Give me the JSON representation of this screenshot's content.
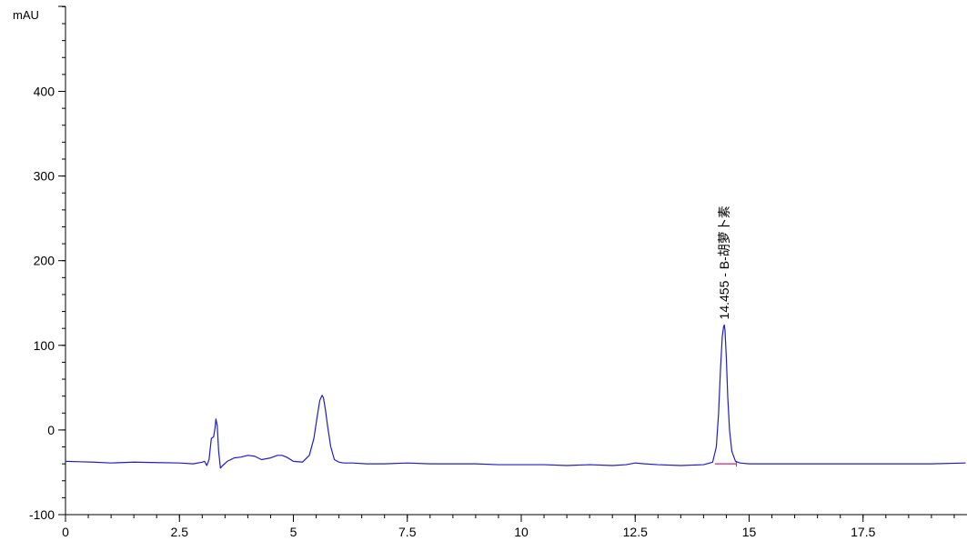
{
  "chart_data": {
    "type": "line",
    "title": "",
    "xlabel": "",
    "ylabel": "mAU",
    "xlim": [
      0,
      19.75
    ],
    "ylim": [
      -100,
      500
    ],
    "x_ticks": [
      0,
      2.5,
      5,
      7.5,
      10,
      12.5,
      15,
      17.5
    ],
    "x_tick_labels": [
      "0",
      "2.5",
      "5",
      "7.5",
      "10",
      "12.5",
      "15",
      "17.5"
    ],
    "x_minor_step": 0.5,
    "y_ticks": [
      -100,
      0,
      100,
      200,
      300,
      400
    ],
    "y_tick_labels": [
      "-100",
      "0",
      "100",
      "200",
      "300",
      "400"
    ],
    "y_minor_step": 20,
    "grid": false,
    "series": [
      {
        "color": "#1f1fbf",
        "x": [
          0,
          0.3,
          0.6,
          1.0,
          1.5,
          2.0,
          2.5,
          2.8,
          3.0,
          3.05,
          3.1,
          3.15,
          3.2,
          3.25,
          3.28,
          3.3,
          3.33,
          3.36,
          3.4,
          3.45,
          3.55,
          3.7,
          3.85,
          4.0,
          4.15,
          4.3,
          4.5,
          4.65,
          4.75,
          4.85,
          5.0,
          5.2,
          5.35,
          5.45,
          5.52,
          5.58,
          5.63,
          5.66,
          5.7,
          5.75,
          5.82,
          5.9,
          6.0,
          6.1,
          6.3,
          6.6,
          7.0,
          7.5,
          8.0,
          8.5,
          9.0,
          9.5,
          10.0,
          10.5,
          11.0,
          11.5,
          12.0,
          12.3,
          12.5,
          12.7,
          13.0,
          13.5,
          14.0,
          14.2,
          14.28,
          14.33,
          14.37,
          14.41,
          14.44,
          14.455,
          14.47,
          14.5,
          14.53,
          14.57,
          14.62,
          14.7,
          14.8,
          15.0,
          15.5,
          16.0,
          16.5,
          17.0,
          17.5,
          18.0,
          18.5,
          19.0,
          19.75
        ],
        "y": [
          -37,
          -37.5,
          -38,
          -39,
          -38,
          -38.5,
          -39,
          -40,
          -38,
          -37,
          -42,
          -35,
          -10,
          -8,
          2,
          13,
          5,
          -25,
          -45,
          -42,
          -37,
          -33,
          -32,
          -30,
          -31,
          -35,
          -33,
          -30,
          -30,
          -32,
          -37,
          -38,
          -30,
          -10,
          15,
          35,
          41,
          38,
          25,
          5,
          -20,
          -35,
          -38,
          -39,
          -39,
          -40,
          -40,
          -39,
          -40,
          -40,
          -40,
          -41,
          -41,
          -41,
          -42,
          -41,
          -42,
          -41,
          -39,
          -40,
          -41,
          -42,
          -41,
          -38,
          -20,
          20,
          70,
          110,
          122,
          124,
          118,
          85,
          40,
          0,
          -25,
          -37,
          -39,
          -40,
          -40,
          -40,
          -40,
          -40,
          -40,
          -40,
          -40,
          -40,
          -39
        ]
      }
    ],
    "annotations": [
      {
        "x": 14.455,
        "y": 124,
        "text": "14.455 -  B-胡萝卜素",
        "rotation": -90
      }
    ],
    "integration_baseline": {
      "x": [
        14.25,
        14.72
      ],
      "y": [
        -40,
        -40
      ],
      "color": "#d0207a"
    }
  }
}
